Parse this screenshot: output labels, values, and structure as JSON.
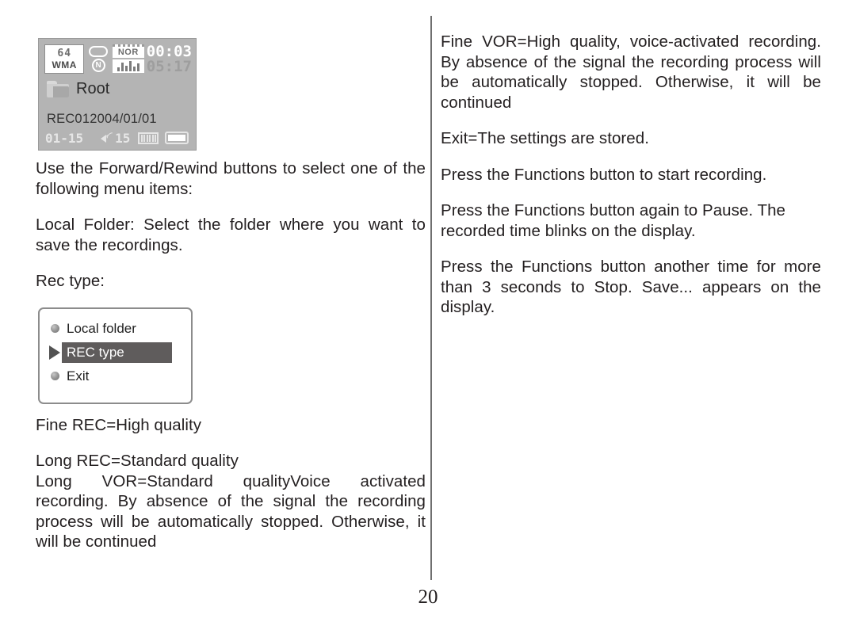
{
  "page": {
    "number": "20"
  },
  "device_display": {
    "format_bitrate": "64",
    "format_codec": "WMA",
    "repeat_mode_letter": "N",
    "eq_mode": "NOR",
    "elapsed_time": "00:03",
    "total_time": "05:17",
    "folder_name": "Root",
    "file_name": "REC012004/01/01",
    "track_position": "01-15",
    "volume_level": "15",
    "icons": {
      "folder": "folder-icon",
      "repeat": "repeat-loop-icon",
      "equalizer": "equalizer-icon",
      "speaker": "speaker-volume-icon",
      "memory_bars": "memory-bars-icon",
      "battery": "battery-icon"
    },
    "colors": {
      "lcd_background": "#b4b4b4",
      "lcd_border": "#9a9a9a",
      "lcd_light_text": "#ffffff",
      "lcd_dim_text": "#9e9e9e",
      "lcd_dark_text": "#2a2a2a"
    }
  },
  "menu_box": {
    "items": [
      {
        "label": "Local folder",
        "marker": "bullet",
        "selected": false
      },
      {
        "label": "REC type",
        "marker": "triangle",
        "selected": true
      },
      {
        "label": "Exit",
        "marker": "bullet",
        "selected": false
      }
    ],
    "colors": {
      "border": "#8c8c8c",
      "highlight_background": "#5f5c5c",
      "highlight_text": "#ffffff"
    }
  },
  "left_column": {
    "paragraphs": [
      "Use the Forward/Rewind buttons to select one of the following menu items:",
      "Local Folder: Select the folder where you want to save the recordings.",
      "Rec type:"
    ],
    "after_menu": [
      "Fine REC=High quality",
      "Long REC=Standard quality",
      "Long VOR=Standard qualityVoice activated recording. By absence of the signal the recording process will be automatically stopped. Otherwise, it will be continued"
    ]
  },
  "right_column": {
    "paragraphs": [
      "Fine VOR=High quality, voice-activated recording. By absence of the signal the recording process will be automatically stopped. Otherwise, it will be continued",
      "Exit=The settings are stored.",
      "Press the Functions button to start recording.",
      "Press the Functions button again to Pause. The recorded time blinks on the display.",
      "Press the Functions button another time for more than 3 seconds to Stop. Save... appears on the display."
    ]
  }
}
